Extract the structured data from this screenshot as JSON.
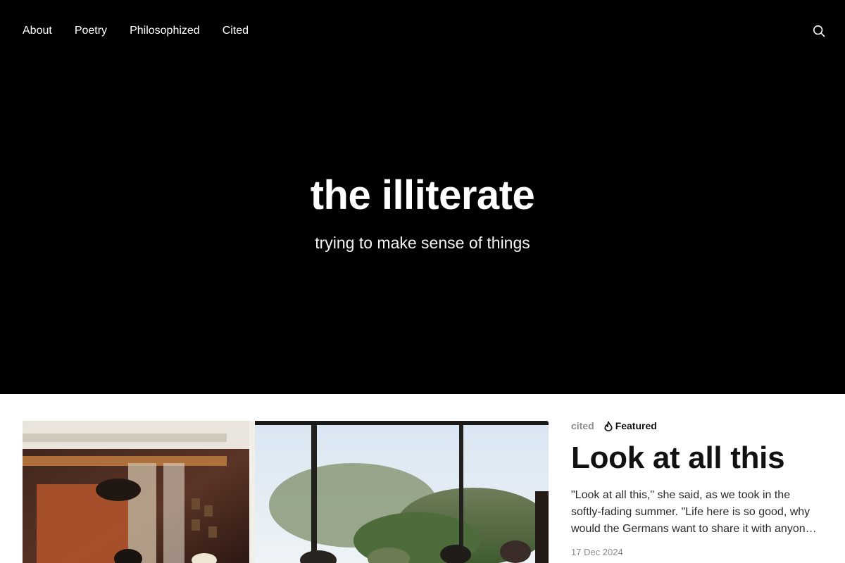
{
  "nav": {
    "items": [
      {
        "label": "About"
      },
      {
        "label": "Poetry"
      },
      {
        "label": "Philosophized"
      },
      {
        "label": "Cited"
      }
    ],
    "search_icon": "search-icon"
  },
  "site": {
    "title": "the illiterate",
    "tagline": "trying to make sense of things"
  },
  "featured_post": {
    "tag": "cited",
    "badge": "Featured",
    "badge_icon": "flame-icon",
    "title": "Look at all this",
    "excerpt": "\"Look at all this,\" she said, as we took in the softly-fading summer. \"Life here is so good, why would the Germans want to share it with anyone else?\"",
    "date": "17 Dec 2024"
  },
  "colors": {
    "hero_background": "#000000",
    "hero_text": "#ffffff",
    "tag_text": "#8c8c8c",
    "title_text": "#111111",
    "date_text": "#8a8a8a"
  }
}
